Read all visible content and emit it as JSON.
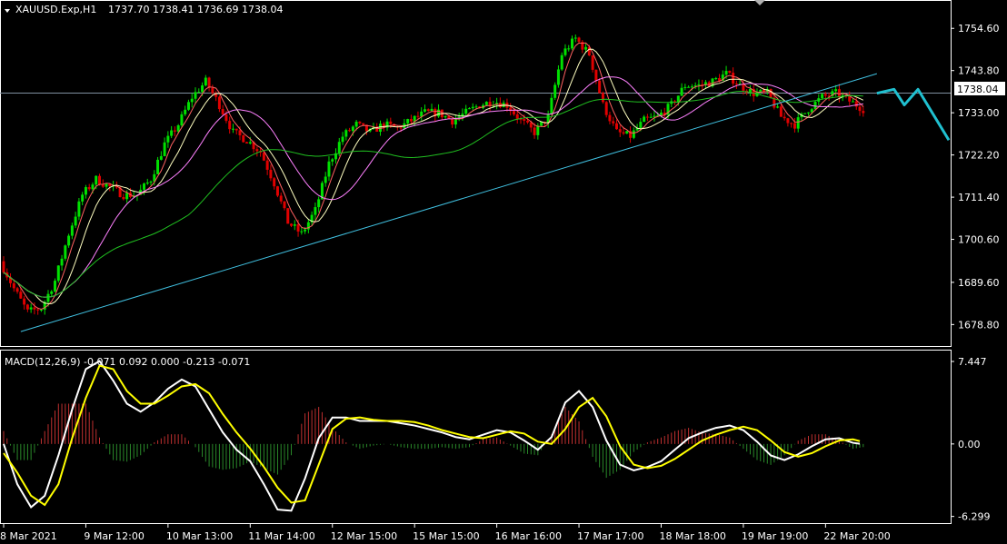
{
  "window": {
    "symbol_header": "XAUUSD.Exp,H1",
    "ohlc": "1737.70 1738.41 1736.69 1738.04"
  },
  "macd_header": {
    "label": "MACD(12,26,9) -0.071 0.092 0.000 -0.213 -0.071"
  },
  "colors": {
    "background": "#000000",
    "bull_candle": "#00e000",
    "bear_candle": "#e00000",
    "ma_fast": "#ff6060",
    "ma_mid": "#ffffc0",
    "ma_slow": "#ff80ff",
    "ma_long": "#20c020",
    "trendline": "#40c0e0",
    "bid_line": "#8090a0",
    "macd_main": "#ffffff",
    "macd_signal": "#ffff00",
    "hist_pos": "#c03030",
    "hist_neg": "#2a8a2a",
    "arrow": "#20c0d0"
  },
  "chart_data": [
    {
      "type": "candlestick",
      "name": "price",
      "ylim": [
        1674.0,
        1760.0
      ],
      "y_ticks": [
        "1754.60",
        "1743.80",
        "1733.00",
        "1722.20",
        "1711.40",
        "1700.60",
        "1689.60",
        "1678.80"
      ],
      "y_tick_values": [
        1754.6,
        1743.8,
        1733.0,
        1722.2,
        1711.4,
        1700.6,
        1689.6,
        1678.8
      ],
      "current_price_label": "1738.04",
      "current_price": 1738.04,
      "x_labels": [
        "8 Mar 2021",
        "9 Mar 12:00",
        "10 Mar 13:00",
        "11 Mar 14:00",
        "12 Mar 15:00",
        "15 Mar 15:00",
        "16 Mar 16:00",
        "17 Mar 17:00",
        "18 Mar 18:00",
        "19 Mar 19:00",
        "22 Mar 20:00"
      ],
      "close_path": [
        [
          0,
          1695
        ],
        [
          4,
          1688
        ],
        [
          8,
          1682
        ],
        [
          12,
          1683
        ],
        [
          16,
          1690
        ],
        [
          20,
          1702
        ],
        [
          24,
          1712
        ],
        [
          28,
          1716
        ],
        [
          32,
          1714
        ],
        [
          36,
          1712
        ],
        [
          40,
          1712
        ],
        [
          44,
          1716
        ],
        [
          48,
          1725
        ],
        [
          52,
          1730
        ],
        [
          56,
          1737
        ],
        [
          60,
          1741
        ],
        [
          64,
          1735
        ],
        [
          68,
          1728
        ],
        [
          72,
          1726
        ],
        [
          76,
          1723
        ],
        [
          80,
          1715
        ],
        [
          84,
          1705
        ],
        [
          88,
          1702
        ],
        [
          92,
          1708
        ],
        [
          96,
          1720
        ],
        [
          100,
          1727
        ],
        [
          104,
          1730
        ],
        [
          108,
          1728
        ],
        [
          112,
          1730
        ],
        [
          116,
          1729
        ],
        [
          120,
          1731
        ],
        [
          124,
          1733
        ],
        [
          128,
          1733
        ],
        [
          132,
          1731
        ],
        [
          136,
          1733
        ],
        [
          140,
          1735
        ],
        [
          144,
          1736
        ],
        [
          148,
          1735
        ],
        [
          152,
          1731
        ],
        [
          156,
          1728
        ],
        [
          160,
          1732
        ],
        [
          164,
          1748
        ],
        [
          168,
          1752
        ],
        [
          172,
          1748
        ],
        [
          176,
          1735
        ],
        [
          180,
          1728
        ],
        [
          184,
          1727
        ],
        [
          188,
          1731
        ],
        [
          192,
          1732
        ],
        [
          196,
          1735
        ],
        [
          200,
          1740
        ],
        [
          204,
          1740
        ],
        [
          208,
          1741
        ],
        [
          212,
          1743
        ],
        [
          216,
          1740
        ],
        [
          220,
          1738
        ],
        [
          224,
          1738
        ],
        [
          228,
          1732
        ],
        [
          232,
          1730
        ],
        [
          236,
          1734
        ],
        [
          240,
          1737
        ],
        [
          244,
          1738
        ],
        [
          248,
          1736
        ],
        [
          252,
          1734
        ]
      ],
      "trendline": [
        [
          5,
          1677
        ],
        [
          255,
          1743
        ]
      ],
      "forecast_arrow": [
        [
          255,
          1738
        ],
        [
          260,
          1739
        ],
        [
          263,
          1735
        ],
        [
          267,
          1739
        ],
        [
          276,
          1726
        ]
      ]
    },
    {
      "type": "macd",
      "name": "MACD(12,26,9)",
      "ylim": [
        -6.8,
        7.8
      ],
      "y_ticks": [
        "7.447",
        "0.00",
        "-6.299"
      ],
      "y_tick_values": [
        7.447,
        0.0,
        -6.299
      ],
      "main": [
        [
          0,
          0.0
        ],
        [
          4,
          -3.5
        ],
        [
          8,
          -5.5
        ],
        [
          12,
          -4.5
        ],
        [
          16,
          -1.0
        ],
        [
          20,
          3.0
        ],
        [
          24,
          6.5
        ],
        [
          28,
          7.2
        ],
        [
          32,
          5.5
        ],
        [
          36,
          3.5
        ],
        [
          40,
          2.8
        ],
        [
          44,
          3.6
        ],
        [
          48,
          4.8
        ],
        [
          52,
          5.6
        ],
        [
          56,
          5.0
        ],
        [
          60,
          3.0
        ],
        [
          64,
          1.0
        ],
        [
          68,
          -0.5
        ],
        [
          72,
          -1.5
        ],
        [
          76,
          -3.5
        ],
        [
          80,
          -5.7
        ],
        [
          84,
          -5.8
        ],
        [
          88,
          -3.0
        ],
        [
          92,
          0.5
        ],
        [
          96,
          2.3
        ],
        [
          100,
          2.3
        ],
        [
          104,
          2.0
        ],
        [
          108,
          2.0
        ],
        [
          112,
          2.0
        ],
        [
          116,
          1.8
        ],
        [
          120,
          1.6
        ],
        [
          124,
          1.3
        ],
        [
          128,
          1.0
        ],
        [
          132,
          0.6
        ],
        [
          136,
          0.4
        ],
        [
          140,
          0.8
        ],
        [
          144,
          1.2
        ],
        [
          148,
          1.0
        ],
        [
          152,
          0.3
        ],
        [
          156,
          -0.5
        ],
        [
          160,
          0.6
        ],
        [
          164,
          3.6
        ],
        [
          168,
          4.6
        ],
        [
          172,
          3.2
        ],
        [
          176,
          0.3
        ],
        [
          180,
          -1.8
        ],
        [
          184,
          -2.3
        ],
        [
          188,
          -2.0
        ],
        [
          192,
          -1.5
        ],
        [
          196,
          -0.5
        ],
        [
          200,
          0.5
        ],
        [
          204,
          1.0
        ],
        [
          208,
          1.4
        ],
        [
          212,
          1.6
        ],
        [
          216,
          1.2
        ],
        [
          220,
          0.2
        ],
        [
          224,
          -1.0
        ],
        [
          228,
          -1.4
        ],
        [
          232,
          -0.9
        ],
        [
          236,
          -0.2
        ],
        [
          240,
          0.4
        ],
        [
          244,
          0.5
        ],
        [
          248,
          0.1
        ],
        [
          252,
          -0.07
        ]
      ],
      "signal": [
        [
          0,
          -0.8
        ],
        [
          4,
          -2.5
        ],
        [
          8,
          -4.5
        ],
        [
          12,
          -5.3
        ],
        [
          16,
          -3.5
        ],
        [
          20,
          0.5
        ],
        [
          24,
          4.0
        ],
        [
          28,
          6.8
        ],
        [
          32,
          6.5
        ],
        [
          36,
          4.6
        ],
        [
          40,
          3.5
        ],
        [
          44,
          3.5
        ],
        [
          48,
          4.2
        ],
        [
          52,
          5.0
        ],
        [
          56,
          5.2
        ],
        [
          60,
          4.4
        ],
        [
          64,
          2.6
        ],
        [
          68,
          1.0
        ],
        [
          72,
          -0.4
        ],
        [
          76,
          -2.0
        ],
        [
          80,
          -3.8
        ],
        [
          84,
          -5.1
        ],
        [
          88,
          -4.9
        ],
        [
          92,
          -1.8
        ],
        [
          96,
          1.3
        ],
        [
          100,
          2.2
        ],
        [
          104,
          2.3
        ],
        [
          108,
          2.1
        ],
        [
          112,
          2.0
        ],
        [
          116,
          2.0
        ],
        [
          120,
          1.9
        ],
        [
          124,
          1.6
        ],
        [
          128,
          1.2
        ],
        [
          132,
          0.9
        ],
        [
          136,
          0.6
        ],
        [
          140,
          0.5
        ],
        [
          144,
          0.8
        ],
        [
          148,
          1.1
        ],
        [
          152,
          0.9
        ],
        [
          156,
          0.2
        ],
        [
          160,
          0.0
        ],
        [
          164,
          1.3
        ],
        [
          168,
          3.2
        ],
        [
          172,
          4.0
        ],
        [
          176,
          2.4
        ],
        [
          180,
          -0.2
        ],
        [
          184,
          -1.8
        ],
        [
          188,
          -2.1
        ],
        [
          192,
          -1.9
        ],
        [
          196,
          -1.3
        ],
        [
          200,
          -0.5
        ],
        [
          204,
          0.3
        ],
        [
          208,
          0.8
        ],
        [
          212,
          1.2
        ],
        [
          216,
          1.5
        ],
        [
          220,
          1.2
        ],
        [
          224,
          0.3
        ],
        [
          228,
          -0.7
        ],
        [
          232,
          -1.1
        ],
        [
          236,
          -0.8
        ],
        [
          240,
          -0.2
        ],
        [
          244,
          0.3
        ],
        [
          248,
          0.4
        ],
        [
          252,
          0.09
        ]
      ]
    }
  ]
}
